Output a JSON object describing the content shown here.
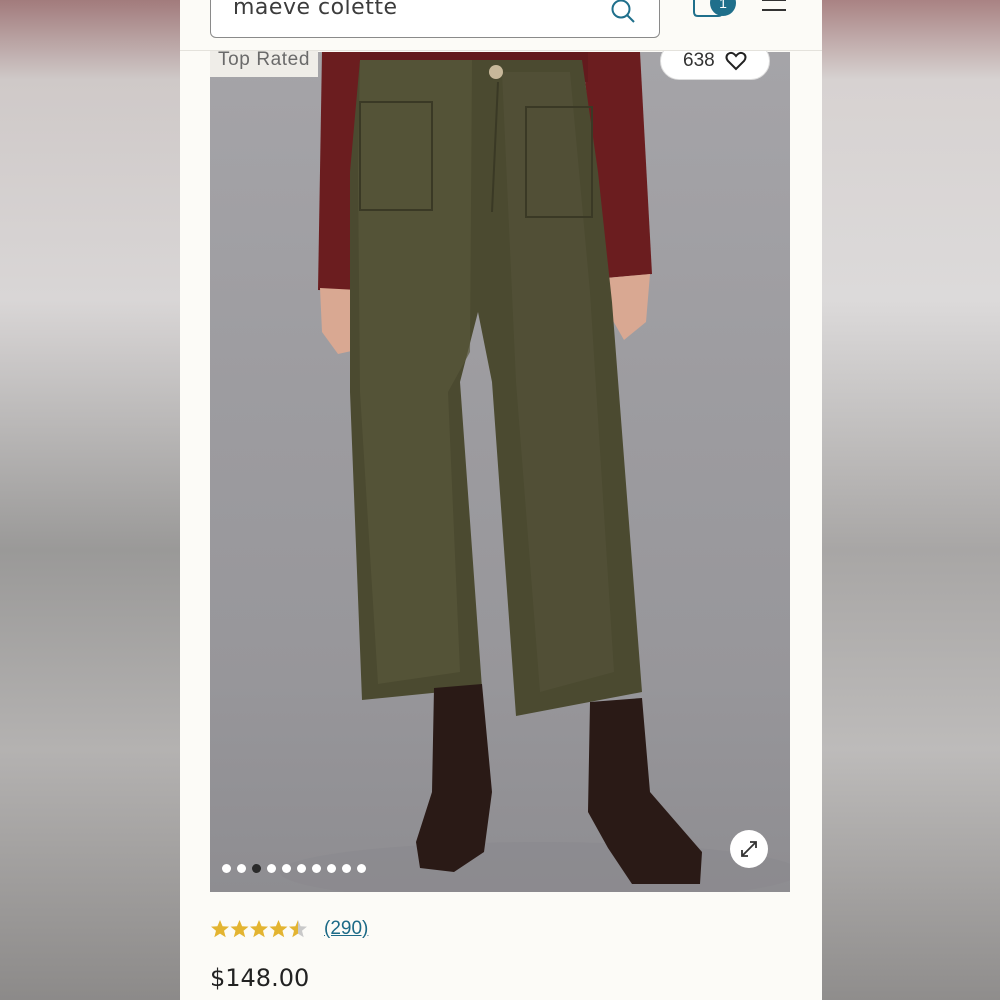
{
  "header": {
    "search_value": "maeve colette",
    "bag_count": "1"
  },
  "product": {
    "badge": "Top Rated",
    "favorites_count": "638",
    "image_count": 10,
    "active_image_index": 2,
    "rating_value": 4.5,
    "rating_max": 5,
    "review_count_label": "(290)",
    "price": "$148.00"
  },
  "colors": {
    "accent": "#1f6f8b",
    "star": "#e3b431"
  },
  "icons": [
    "search-icon",
    "bag-icon",
    "menu-icon",
    "heart-icon",
    "expand-icon",
    "star-icon"
  ]
}
